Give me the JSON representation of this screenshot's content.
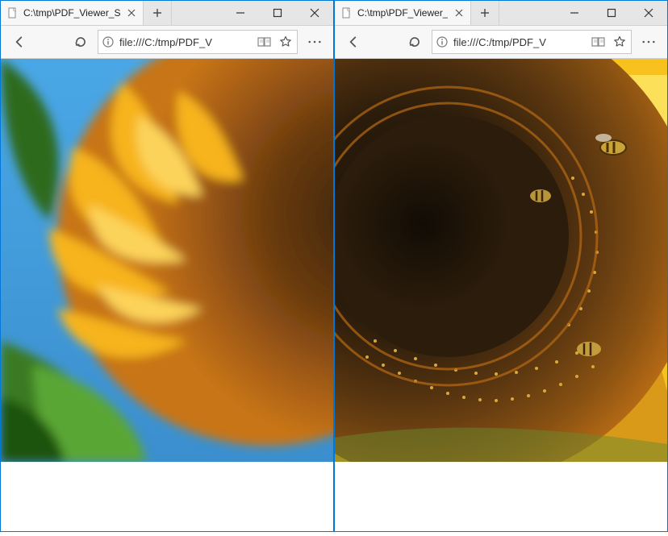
{
  "windows": [
    {
      "tab": {
        "title": "C:\\tmp\\PDF_Viewer_SDI"
      },
      "address": {
        "url": "file:///C:/tmp/PDF_V"
      }
    },
    {
      "tab": {
        "title": "C:\\tmp\\PDF_Viewer_"
      },
      "address": {
        "url": "file:///C:/tmp/PDF_V"
      }
    }
  ]
}
